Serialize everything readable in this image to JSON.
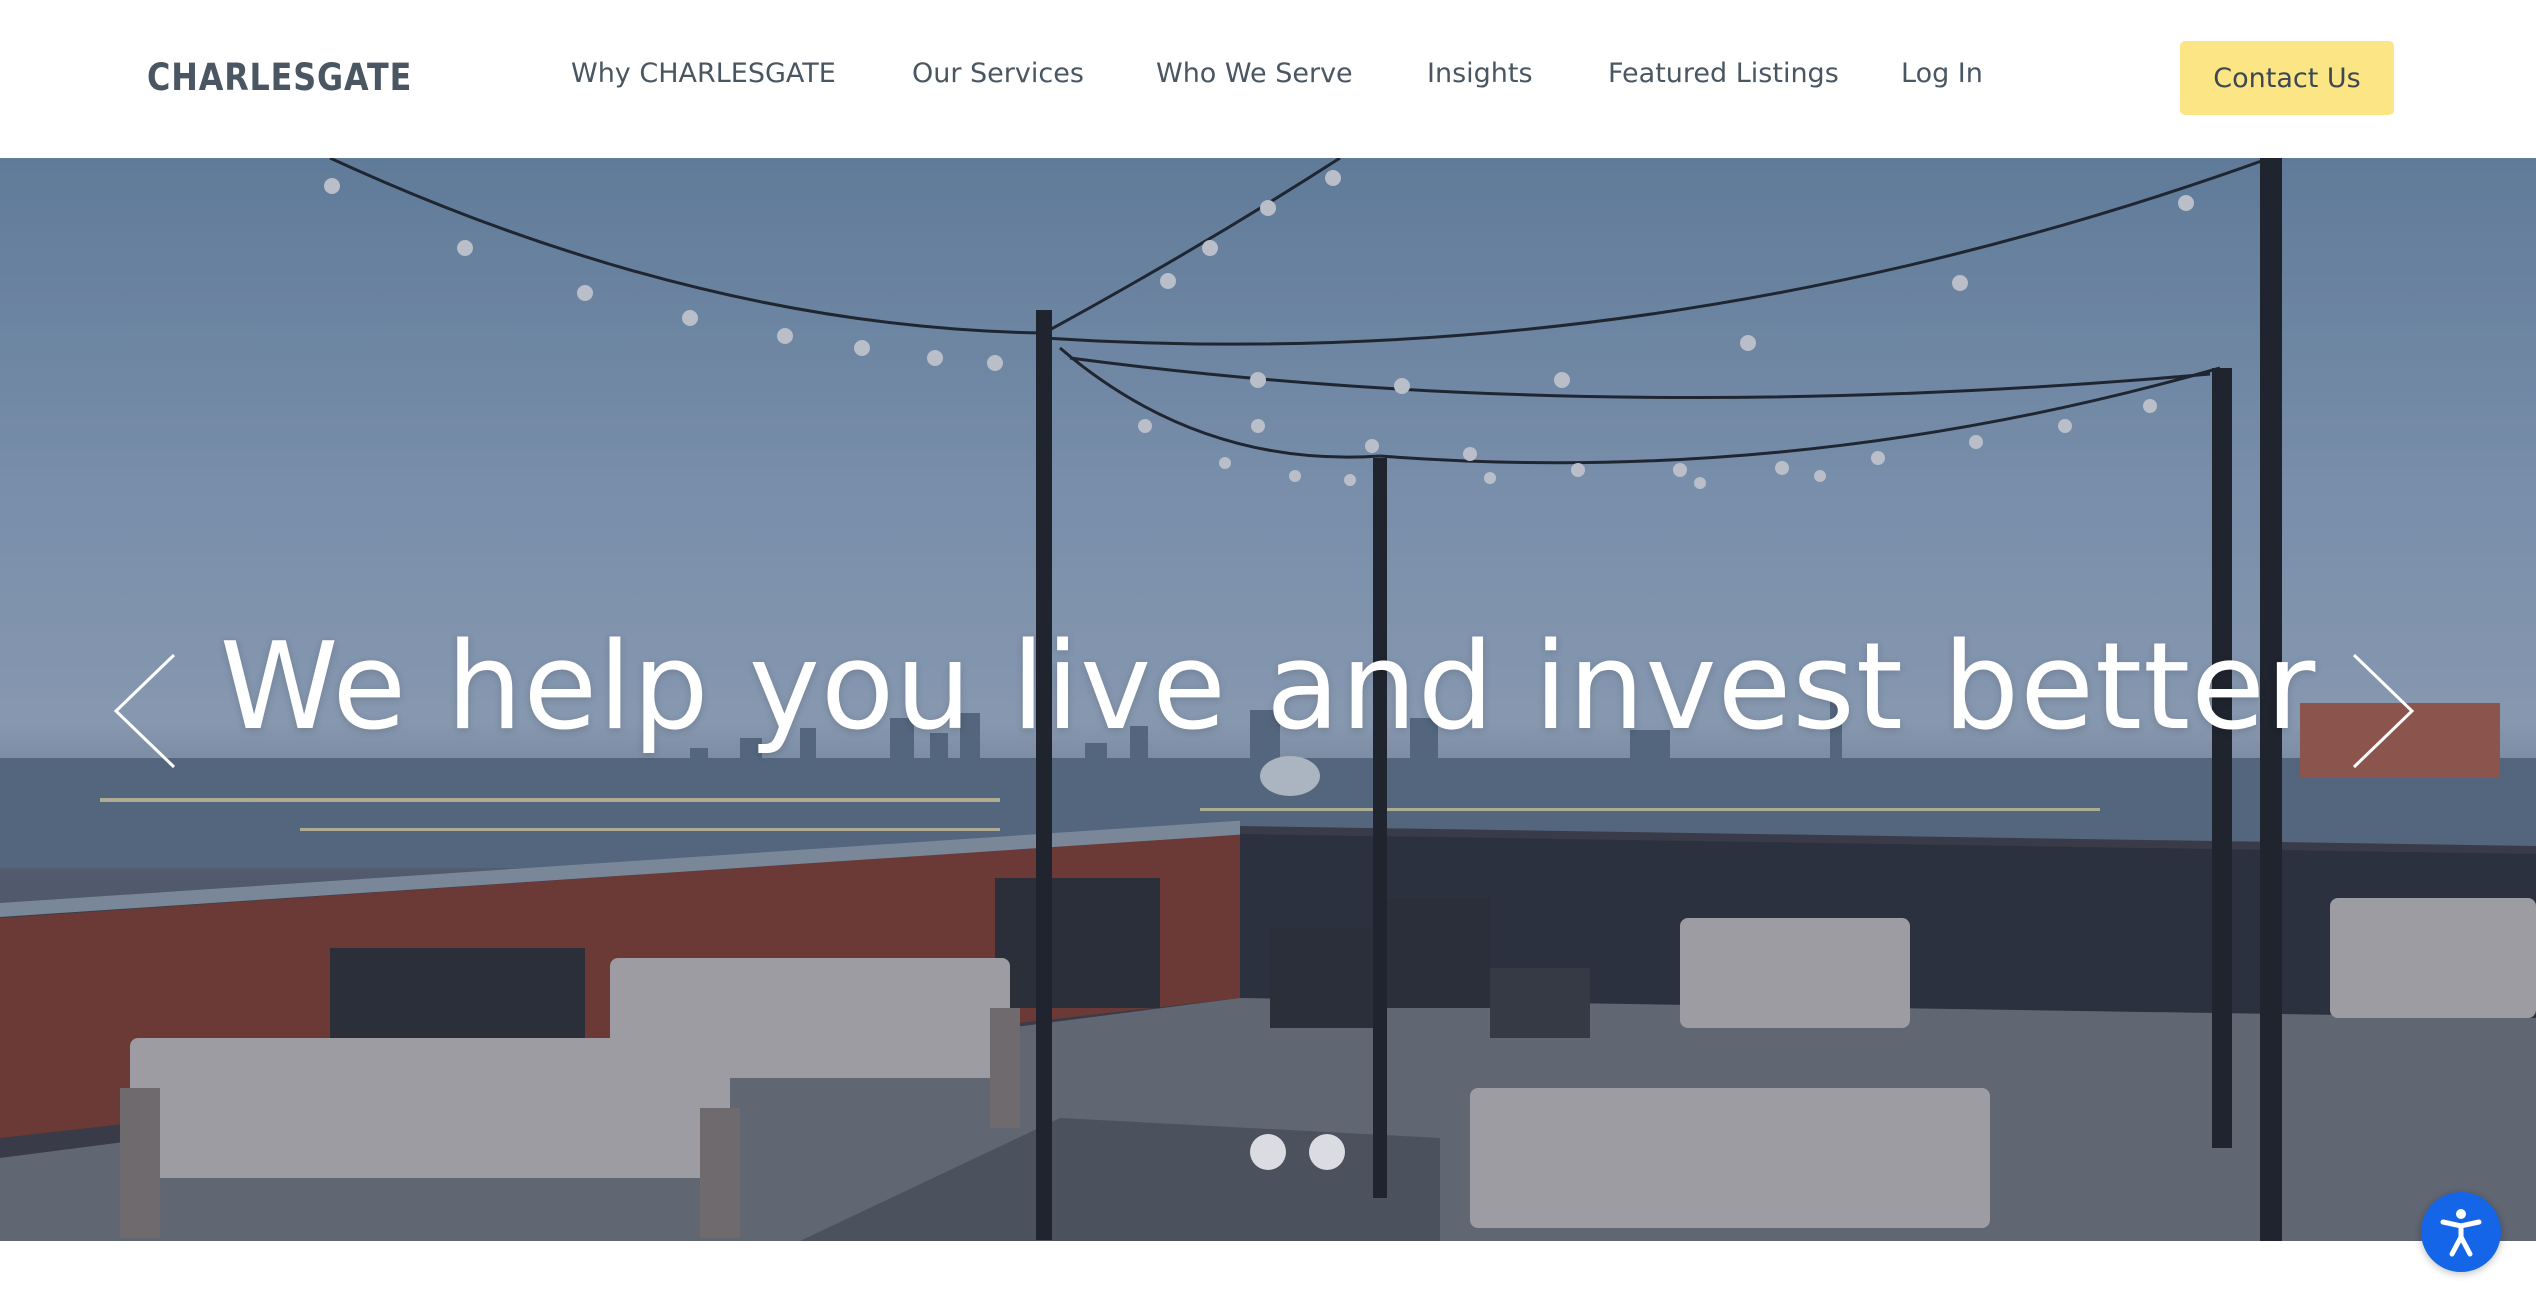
{
  "brand": {
    "logo_text": "CHARLESGATE"
  },
  "nav": {
    "items": [
      {
        "label": "Why CHARLESGATE"
      },
      {
        "label": "Our Services"
      },
      {
        "label": "Who We Serve"
      },
      {
        "label": "Insights"
      },
      {
        "label": "Featured Listings"
      },
      {
        "label": "Log In"
      }
    ],
    "contact_label": "Contact Us"
  },
  "hero": {
    "headline": "We help you live and invest better",
    "slide_count": 2,
    "prev_icon": "chevron-left-icon",
    "next_icon": "chevron-right-icon"
  },
  "accessibility": {
    "icon": "accessibility-icon"
  },
  "colors": {
    "text": "#4a5662",
    "button_bg": "#fbe585",
    "accessibility_bg": "#1565e8",
    "headline": "#ffffff"
  }
}
